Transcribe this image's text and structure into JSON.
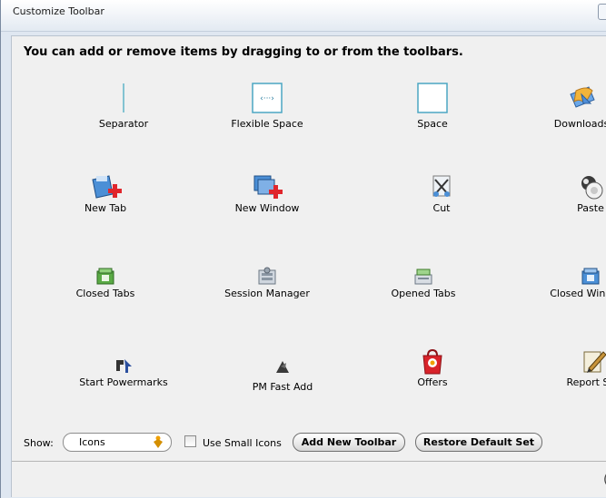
{
  "window": {
    "title": "Customize Toolbar"
  },
  "heading": "You can add or remove items by dragging to or from the toolbars.",
  "items": [
    {
      "label": "Separator",
      "icon": "separator-icon"
    },
    {
      "label": "Flexible Space",
      "icon": "flexible-space-icon"
    },
    {
      "label": "Space",
      "icon": "space-icon"
    },
    {
      "label": "Downloads",
      "icon": "downloads-icon"
    },
    {
      "label": "New Tab",
      "icon": "new-tab-icon"
    },
    {
      "label": "New Window",
      "icon": "new-window-icon"
    },
    {
      "label": "Cut",
      "icon": "cut-icon"
    },
    {
      "label": "Paste",
      "icon": "paste-icon"
    },
    {
      "label": "Closed Tabs",
      "icon": "closed-tabs-icon"
    },
    {
      "label": "Session Manager",
      "icon": "session-manager-icon"
    },
    {
      "label": "Opened Tabs",
      "icon": "opened-tabs-icon"
    },
    {
      "label": "Closed Windows",
      "icon": "closed-windows-icon"
    },
    {
      "label": "Start Powermarks",
      "icon": "start-powermarks-icon"
    },
    {
      "label": "PM Fast Add",
      "icon": "pm-fast-add-icon"
    },
    {
      "label": "Offers",
      "icon": "offers-icon"
    },
    {
      "label": "Report Site",
      "icon": "report-site-icon"
    }
  ],
  "controls": {
    "show_label": "Show:",
    "show_value": "Icons",
    "small_icons_label": "Use Small Icons",
    "small_icons_checked": false,
    "add_toolbar_label": "Add New Toolbar",
    "restore_label": "Restore Default Set"
  }
}
